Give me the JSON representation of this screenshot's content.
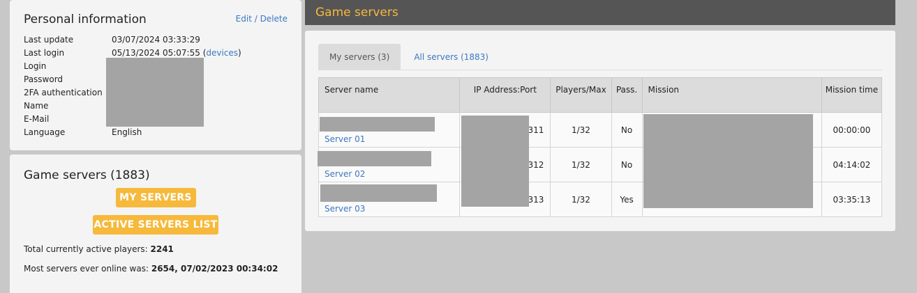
{
  "personal": {
    "title": "Personal information",
    "edit_label": "Edit / Delete",
    "rows": [
      {
        "label": "Last update",
        "value": "03/07/2024 03:33:29"
      },
      {
        "label": "Last login",
        "value": "05/13/2024 05:07:55 (",
        "link": "devices",
        "suffix": ")"
      },
      {
        "label": "Login",
        "value": ""
      },
      {
        "label": "Password",
        "value": ""
      },
      {
        "label": "2FA authentication",
        "value": ""
      },
      {
        "label": "Name",
        "value": ""
      },
      {
        "label": "E-Mail",
        "value": ""
      },
      {
        "label": "Language",
        "value": "English"
      }
    ]
  },
  "game_servers_panel": {
    "title": "Game servers (1883)",
    "my_servers_button": "MY SERVERS",
    "active_servers_button": "ACTIVE SERVERS LIST",
    "players_label": "Total currently active players: ",
    "players_value": "2241",
    "max_label": "Most servers ever online was: ",
    "max_value": "2654, 07/02/2023 00:34:02"
  },
  "main": {
    "header_title": "Game servers",
    "tabs": [
      {
        "label": "My servers (3)",
        "active": true
      },
      {
        "label": "All servers (1883)",
        "active": false
      }
    ],
    "columns": [
      "Server name",
      "IP Address:Port",
      "Players/Max",
      "Pass.",
      "Mission",
      "Mission time"
    ],
    "rows": [
      {
        "name": "Server 01",
        "ip": "0311",
        "players": "1/32",
        "pass": "No",
        "mission": "",
        "time": "00:00:00"
      },
      {
        "name": "Server 02",
        "ip": "0312",
        "players": "1/32",
        "pass": "No",
        "mission": "",
        "time": "04:14:02"
      },
      {
        "name": "Server 03",
        "ip": "0313",
        "players": "1/32",
        "pass": "Yes",
        "mission": "",
        "time": "03:35:13"
      }
    ]
  },
  "colors": {
    "accent": "#f6b93b",
    "link": "#3b78c2",
    "header_bg": "#555556",
    "redaction": "#a4a4a4"
  }
}
